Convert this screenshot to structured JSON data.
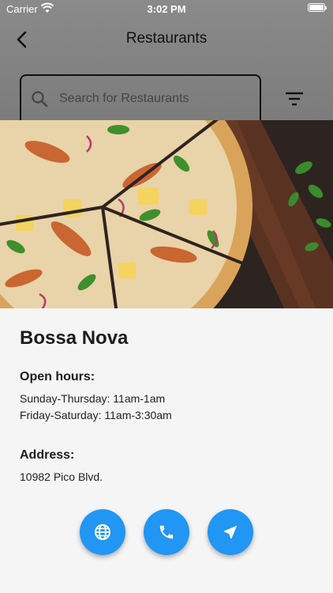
{
  "status_bar": {
    "carrier": "Carrier",
    "time": "3:02 PM"
  },
  "header": {
    "title": "Restaurants",
    "back_icon": "chevron-left-icon",
    "filter_icon": "filter-icon"
  },
  "search": {
    "placeholder": "Search for Restaurants",
    "value": ""
  },
  "hero": {
    "subject": "pizza photo"
  },
  "restaurant": {
    "name": "Bossa Nova",
    "hours_heading": "Open hours:",
    "hours": [
      "Sunday-Thursday: 11am-1am",
      "Friday-Saturday: 11am-3:30am"
    ],
    "address_heading": "Address:",
    "address": "10982 Pico Blvd."
  },
  "actions": [
    {
      "icon": "globe-icon"
    },
    {
      "icon": "phone-icon"
    },
    {
      "icon": "navigation-icon"
    }
  ],
  "colors": {
    "accent": "#2196f3",
    "header_bg": "#838383"
  }
}
